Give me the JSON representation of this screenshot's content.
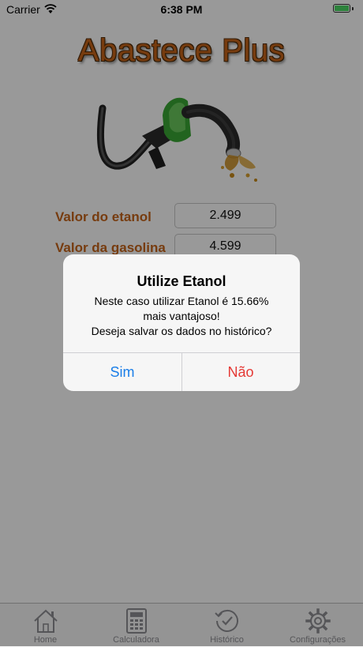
{
  "status_bar": {
    "carrier": "Carrier",
    "time": "6:38 PM"
  },
  "app": {
    "title": "Abastece Plus"
  },
  "form": {
    "ethanol_label": "Valor do etanol",
    "ethanol_value": "2.499",
    "gasoline_label": "Valor da gasolina",
    "gasoline_value": "4.599"
  },
  "tabs": [
    {
      "label": "Home",
      "icon": "home-icon"
    },
    {
      "label": "Calculadora",
      "icon": "calculator-icon"
    },
    {
      "label": "Histórico",
      "icon": "history-icon"
    },
    {
      "label": "Configurações",
      "icon": "gear-icon"
    }
  ],
  "alert": {
    "title": "Utilize Etanol",
    "message_line1": "Neste caso utilizar Etanol é 15.66%",
    "message_line2": "mais vantajoso!",
    "message_line3": "Deseja salvar os dados no histórico?",
    "yes_label": "Sim",
    "no_label": "Não"
  },
  "colors": {
    "brand_orange": "#c6641a",
    "alert_blue": "#1a7ee8",
    "alert_red": "#e53935",
    "pump_green": "#3aa735"
  }
}
